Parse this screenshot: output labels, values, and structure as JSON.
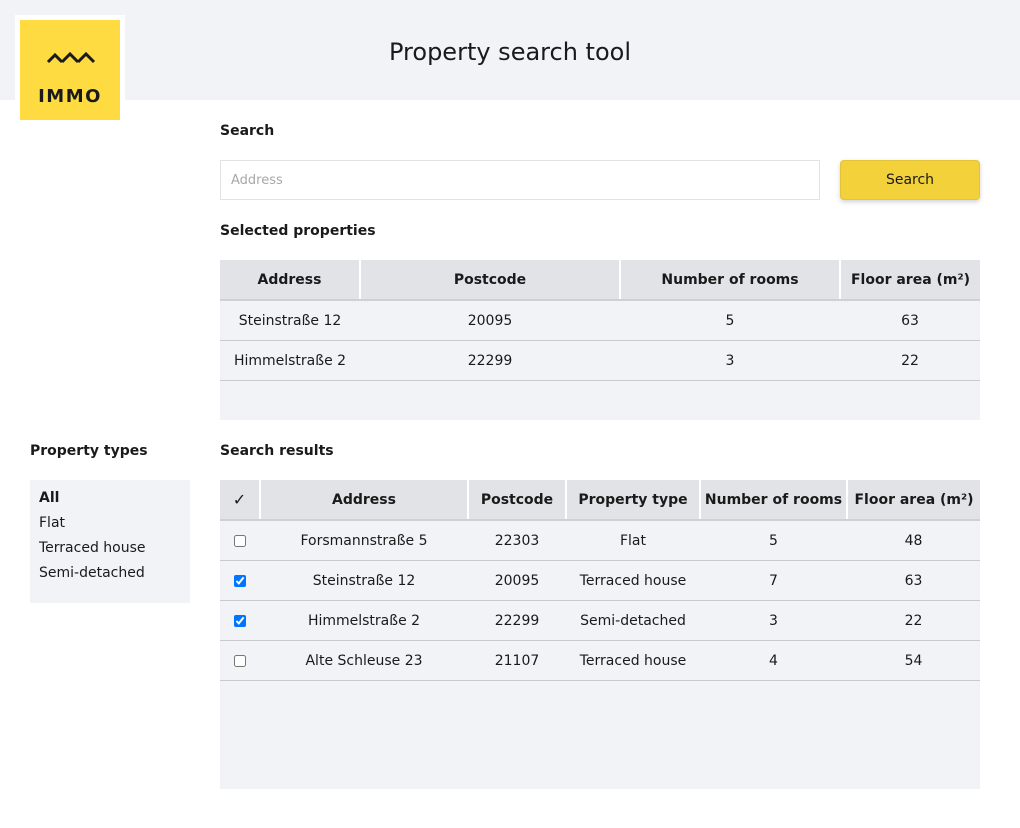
{
  "app": {
    "title": "Property search tool",
    "logo_text": "IMMO",
    "brand_color": "#fedb41"
  },
  "search": {
    "section_label": "Search",
    "placeholder": "Address",
    "value": "",
    "button_label": "Search"
  },
  "selected": {
    "section_label": "Selected properties",
    "columns": [
      "Address",
      "Postcode",
      "Number of rooms",
      "Floor area (m²)"
    ],
    "rows": [
      {
        "address": "Steinstraße 12",
        "postcode": "20095",
        "rooms": "5",
        "area": "63"
      },
      {
        "address": "Himmelstraße 2",
        "postcode": "22299",
        "rooms": "3",
        "area": "22"
      }
    ]
  },
  "filters": {
    "section_label": "Property types",
    "items": [
      {
        "label": "All",
        "active": true
      },
      {
        "label": "Flat",
        "active": false
      },
      {
        "label": "Terraced house",
        "active": false
      },
      {
        "label": "Semi-detached",
        "active": false
      }
    ]
  },
  "results": {
    "section_label": "Search results",
    "check_header": "✓",
    "columns": [
      "Address",
      "Postcode",
      "Property type",
      "Number of rooms",
      "Floor area (m²)"
    ],
    "rows": [
      {
        "checked": false,
        "address": "Forsmannstraße 5",
        "postcode": "22303",
        "type": "Flat",
        "rooms": "5",
        "area": "48"
      },
      {
        "checked": true,
        "address": "Steinstraße 12",
        "postcode": "20095",
        "type": "Terraced house",
        "rooms": "7",
        "area": "63"
      },
      {
        "checked": true,
        "address": "Himmelstraße 2",
        "postcode": "22299",
        "type": "Semi-detached",
        "rooms": "3",
        "area": "22"
      },
      {
        "checked": false,
        "address": "Alte Schleuse 23",
        "postcode": "21107",
        "type": "Terraced house",
        "rooms": "4",
        "area": "54"
      }
    ]
  }
}
